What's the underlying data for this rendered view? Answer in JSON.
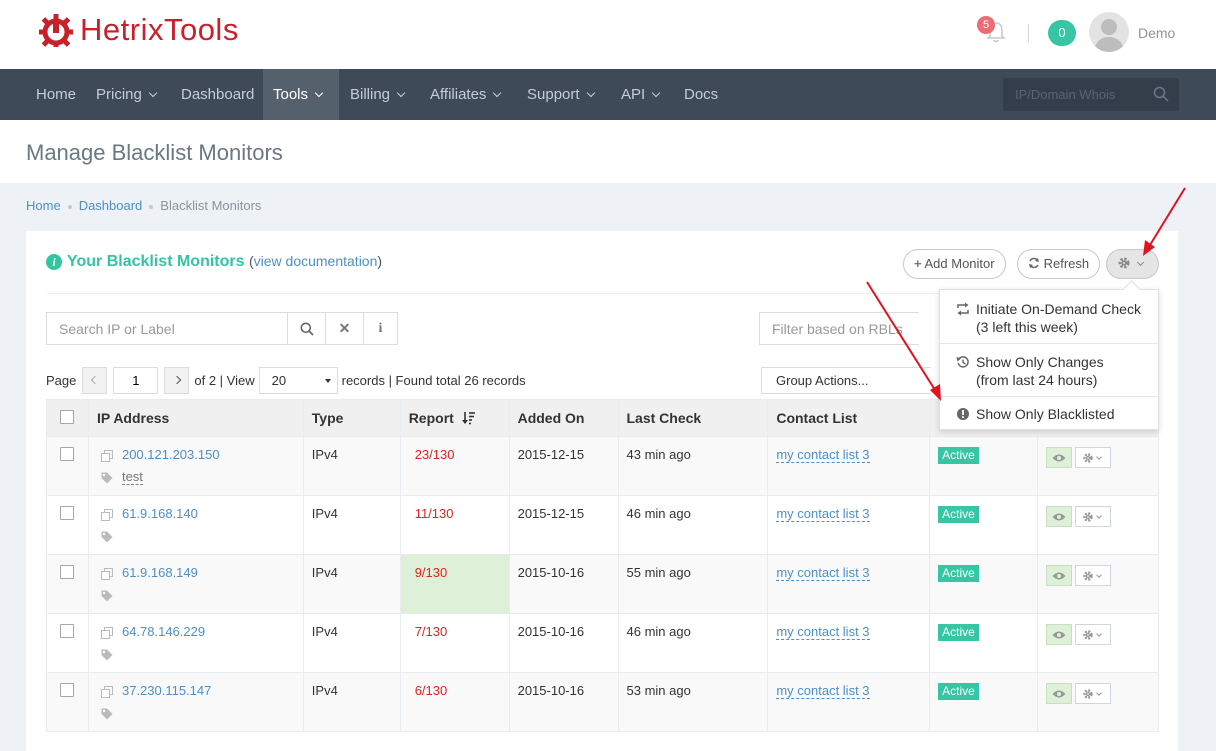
{
  "brand": {
    "name": "HetrixTools",
    "color": "#c7222b"
  },
  "header": {
    "notifications_count": "5",
    "credits": "0",
    "username": "Demo"
  },
  "nav": {
    "items": [
      {
        "label": "Home",
        "has_caret": false
      },
      {
        "label": "Pricing",
        "has_caret": true
      },
      {
        "label": "Dashboard",
        "has_caret": false
      },
      {
        "label": "Tools",
        "has_caret": true,
        "active": true
      },
      {
        "label": "Billing",
        "has_caret": true
      },
      {
        "label": "Affiliates",
        "has_caret": true
      },
      {
        "label": "Support",
        "has_caret": true
      },
      {
        "label": "API",
        "has_caret": true
      },
      {
        "label": "Docs",
        "has_caret": false
      }
    ],
    "search_placeholder": "IP/Domain Whois"
  },
  "page": {
    "title": "Manage Blacklist Monitors"
  },
  "breadcrumb": [
    "Home",
    "Dashboard",
    "Blacklist Monitors"
  ],
  "portlet": {
    "title": "Your Blacklist Monitors",
    "doc_open": "(",
    "doc_link": "view documentation",
    "doc_close": ")",
    "add_monitor": "Add Monitor",
    "refresh": "Refresh"
  },
  "toolbar": {
    "search_placeholder": "Search IP or Label",
    "filter_placeholder": "Filter based on RBLs",
    "page_label": "Page",
    "page_value": "1",
    "page_of": "of 2 | View",
    "view_value": "20",
    "records_text": "records | Found total 26 records",
    "group_actions": "Group Actions..."
  },
  "table": {
    "headers": [
      "IP Address",
      "Type",
      "Report",
      "Added On",
      "Last Check",
      "Contact List"
    ],
    "rows": [
      {
        "ip": "200.121.203.150",
        "label": "test",
        "type": "IPv4",
        "report": "23/130",
        "added": "2015-12-15",
        "last_check": "43 min ago",
        "contact": "my contact list 3",
        "status": "Active"
      },
      {
        "ip": "61.9.168.140",
        "label": "",
        "type": "IPv4",
        "report": "11/130",
        "added": "2015-12-15",
        "last_check": "46 min ago",
        "contact": "my contact list 3",
        "status": "Active"
      },
      {
        "ip": "61.9.168.149",
        "label": "",
        "type": "IPv4",
        "report": "9/130",
        "added": "2015-10-16",
        "last_check": "55 min ago",
        "contact": "my contact list 3",
        "status": "Active"
      },
      {
        "ip": "64.78.146.229",
        "label": "",
        "type": "IPv4",
        "report": "7/130",
        "added": "2015-10-16",
        "last_check": "46 min ago",
        "contact": "my contact list 3",
        "status": "Active"
      },
      {
        "ip": "37.230.115.147",
        "label": "",
        "type": "IPv4",
        "report": "6/130",
        "added": "2015-10-16",
        "last_check": "53 min ago",
        "contact": "my contact list 3",
        "status": "Active"
      }
    ]
  },
  "dropdown": {
    "items": [
      {
        "line1": "Initiate On-Demand Check",
        "line2": "(3 left this week)",
        "icon": "retweet-icon"
      },
      {
        "line1": "Show Only Changes",
        "line2": "(from last 24 hours)",
        "icon": "history-icon"
      },
      {
        "line1": "Show Only Blacklisted",
        "line2": "",
        "icon": "exclamation-icon"
      }
    ]
  },
  "colors": {
    "nav_bg": "#3e4a58",
    "accent_green": "#32c5a2",
    "link_blue": "#4d8fc6",
    "report_red": "#e02222",
    "annotation_arrow": "#e0141e"
  }
}
